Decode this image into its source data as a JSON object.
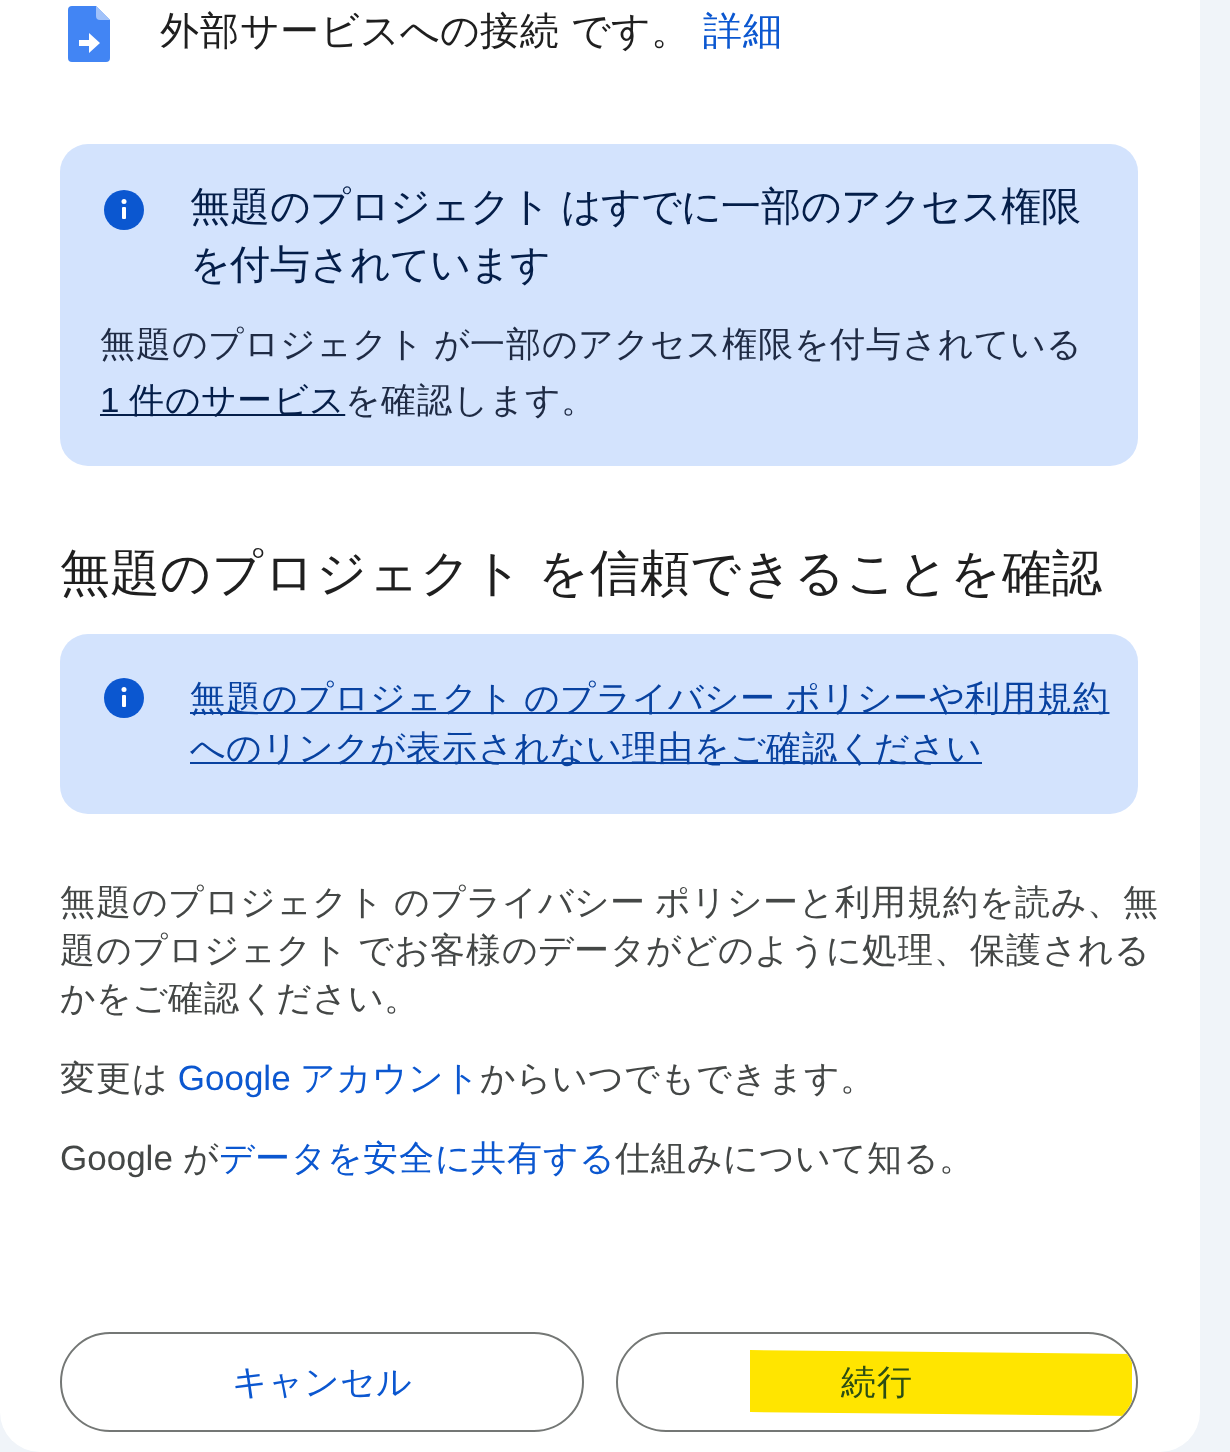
{
  "header": {
    "text": "外部サービスへの接続 です。",
    "link": "詳細"
  },
  "access_notice": {
    "title": "無題のプロジェクト はすでに一部のアクセス権限を付与されています",
    "body": [
      {
        "kind": "text",
        "text": "無題のプロジェクト が一部のアクセス権限を付与されている"
      },
      {
        "kind": "link",
        "text": "1 件のサービス"
      },
      {
        "kind": "text",
        "text": "を確認します。"
      }
    ]
  },
  "trust_heading": "無題のプロジェクト を信頼できることを確認",
  "privacy_notice": {
    "link": "無題のプロジェクト のプライバシー ポリシーや利用規約へのリンクが表示されない理由をご確認ください"
  },
  "paragraphs": [
    {
      "segments": [
        {
          "kind": "text",
          "text": "無題のプロジェクト のプライバシー ポリシーと利用規約を読み、無題のプロジェクト でお客様のデータがどのように処理、保護されるかをご確認ください。"
        }
      ]
    },
    {
      "segments": [
        {
          "kind": "text",
          "text": "変更は "
        },
        {
          "kind": "link",
          "text": "Google アカウント"
        },
        {
          "kind": "text",
          "text": "からいつでもできます。"
        }
      ]
    },
    {
      "segments": [
        {
          "kind": "text",
          "text": "Google が"
        },
        {
          "kind": "link",
          "text": "データを安全に共有する"
        },
        {
          "kind": "text",
          "text": "仕組みについて知る。"
        }
      ]
    }
  ],
  "buttons": [
    {
      "label": "キャンセル",
      "highlighted": false
    },
    {
      "label": "続行",
      "highlighted": true
    }
  ]
}
